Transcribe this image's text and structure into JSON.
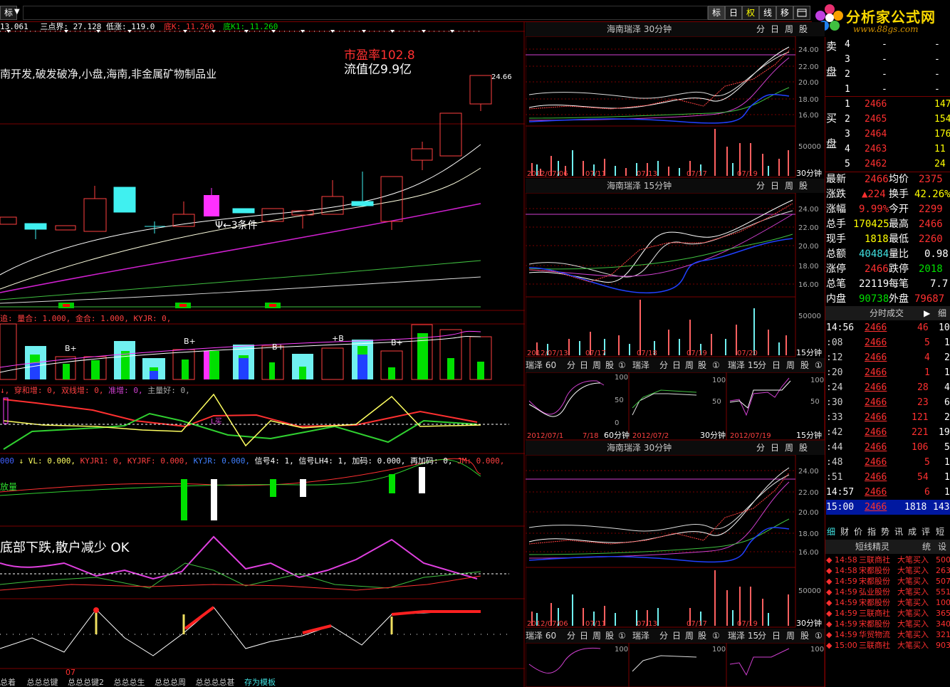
{
  "toolbar": {
    "left_label": "标",
    "dropdown_arrow": "▼",
    "buttons": [
      "标",
      "日",
      "权",
      "线",
      "移"
    ],
    "extra_icons": [
      "window-icon",
      "search-icon"
    ]
  },
  "logo": {
    "title": "分析家公式网",
    "url_text": "www.88gs.com"
  },
  "indicator_line": {
    "v1": "13.061",
    "san_dian_jie": "三点界: 27.128",
    "di_zhang": "低涨: 119.0",
    "di_k": "底K: 11.260",
    "di_k1": "底K1: 11.260"
  },
  "main_chart": {
    "concept_text": "南开发,破发破净,小盘,海南,非金属矿物制品业",
    "pe_text": "市盈率102.8",
    "float_text": "流值亿9.9亿",
    "high_label": "24.66",
    "cond_label": "Ψ←3条件"
  },
  "vol_indicator_line": {
    "text": "追: 量合: 1.000, 金合: 1.000, KYJR: 0,"
  },
  "vol_labels": [
    "B+",
    "B+",
    "B+",
    "+B",
    "B+"
  ],
  "ind2_line": {
    "prefix": "↓, 穿和增: 0, 双线增: 0,",
    "part2": "准增: 0,",
    "part3": "主量好: 0,"
  },
  "ind2_label": "L买",
  "ind3_line": {
    "a": "000",
    "b": "↓ VL: 0.000,",
    "c": "KYJR1: 0, KYJRF: 0.000,",
    "d": "KYJR: 0.000,",
    "e": "信号4: 1, 信号LH4: 1, 加码: 0.000, 再加码: 0,",
    "f": "JM: 0.000,"
  },
  "ind3_label": "放量",
  "ind4_text": "底部下跌,散户减少 OK",
  "bottom_tabs": [
    "总着",
    "总总总键",
    "总总总键2",
    "总总总生",
    "总总总周",
    "总总总总甚",
    "存为模板"
  ],
  "date_marker": "07",
  "mini_charts": {
    "c30_title": "海南瑞泽 30分钟",
    "c15_title": "海南瑞泽 15分钟",
    "c30b_title": "海南瑞泽 30分钟",
    "period_btns": [
      "分",
      "日",
      "周",
      "股"
    ],
    "y_ticks_a": [
      "24.00",
      "22.00",
      "20.00",
      "18.00",
      "16.00"
    ],
    "vol_tick": "50000",
    "dates_a": [
      "2012/07/06",
      "07/11",
      "07/13",
      "07/17",
      "07/19"
    ],
    "dates_b": [
      "2012/07/13",
      "07/17",
      "07/18",
      "07/19",
      "07/20"
    ],
    "label_30": "30分钟",
    "label_15": "15分钟",
    "label_60": "60分钟",
    "small_row_a": [
      "瑞泽 60",
      "分",
      "日",
      "周",
      "股",
      "①",
      "瑞泽",
      "分",
      "日",
      "周",
      "股",
      "①",
      "瑞泽 15",
      "分",
      "日",
      "周",
      "股",
      "①"
    ],
    "small_ticks": [
      "100",
      "50",
      "0"
    ],
    "small_dates": [
      "2012/07/1",
      "7/18",
      "2012/07/2",
      "2012/07/19"
    ]
  },
  "order_book": {
    "sell_label": [
      "卖",
      "盘"
    ],
    "buy_label": [
      "买",
      "盘"
    ],
    "sell": [
      {
        "n": "4",
        "price": "-",
        "vol": "-"
      },
      {
        "n": "3",
        "price": "-",
        "vol": "-"
      },
      {
        "n": "2",
        "price": "-",
        "vol": "-"
      },
      {
        "n": "1",
        "price": "-",
        "vol": "-"
      }
    ],
    "buy": [
      {
        "n": "1",
        "price": "2466",
        "vol": "147"
      },
      {
        "n": "2",
        "price": "2465",
        "vol": "154"
      },
      {
        "n": "3",
        "price": "2464",
        "vol": "176"
      },
      {
        "n": "4",
        "price": "2463",
        "vol": "11"
      },
      {
        "n": "5",
        "price": "2462",
        "vol": "24"
      }
    ]
  },
  "quote": [
    {
      "k1": "最新",
      "v1": "2466",
      "k2": "均价",
      "v2": "2375"
    },
    {
      "k1": "涨跌",
      "v1": "▲224",
      "k2": "换手",
      "v2": "42.26%"
    },
    {
      "k1": "涨幅",
      "v1": "9.99%",
      "k2": "今开",
      "v2": "2299"
    },
    {
      "k1": "总手",
      "v1": "170425",
      "k2": "最高",
      "v2": "2466"
    },
    {
      "k1": "现手",
      "v1": "1818",
      "k2": "最低",
      "v2": "2260"
    },
    {
      "k1": "总额",
      "v1": "40484",
      "k2": "量比",
      "v2": "0.98"
    },
    {
      "k1": "涨停",
      "v1": "2466",
      "k2": "跌停",
      "v2": "2018"
    },
    {
      "k1": "总笔",
      "v1": "22119",
      "k2": "每笔",
      "v2": "7.7"
    },
    {
      "k1": "内盘",
      "v1": "90738",
      "k2": "外盘",
      "v2": "79687"
    }
  ],
  "trade_header": {
    "title": "分时成交",
    "detail": "细"
  },
  "trades": [
    {
      "t": "14:56",
      "p": "2466",
      "v": "46",
      "n": "10"
    },
    {
      "t": ":08",
      "p": "2466",
      "v": "5",
      "n": "1"
    },
    {
      "t": ":12",
      "p": "2466",
      "v": "4",
      "n": "2"
    },
    {
      "t": ":20",
      "p": "2466",
      "v": "1",
      "n": "1"
    },
    {
      "t": ":24",
      "p": "2466",
      "v": "28",
      "n": "4"
    },
    {
      "t": ":30",
      "p": "2466",
      "v": "23",
      "n": "6"
    },
    {
      "t": ":33",
      "p": "2466",
      "v": "121",
      "n": "2"
    },
    {
      "t": ":42",
      "p": "2466",
      "v": "221",
      "n": "19"
    },
    {
      "t": ":44",
      "p": "2466",
      "v": "106",
      "n": "5"
    },
    {
      "t": ":48",
      "p": "2466",
      "v": "5",
      "n": "1"
    },
    {
      "t": ":51",
      "p": "2466",
      "v": "54",
      "n": "1"
    },
    {
      "t": "14:57",
      "p": "2466",
      "v": "6",
      "n": "1"
    },
    {
      "t": "15:00",
      "p": "2466",
      "v": "1818",
      "n": "143"
    }
  ],
  "tabs_row": [
    "细",
    "财",
    "价",
    "指",
    "势",
    "讯",
    "成",
    "评",
    "短"
  ],
  "signal_header": {
    "title": "短线精灵",
    "b1": "统",
    "b2": "设"
  },
  "signals": [
    {
      "t": "14:58",
      "name": "三联商社",
      "type": "大笔买入",
      "v": "500"
    },
    {
      "t": "14:58",
      "name": "宋都股份",
      "type": "大笔买入",
      "v": "263"
    },
    {
      "t": "14:59",
      "name": "宋都股份",
      "type": "大笔买入",
      "v": "507"
    },
    {
      "t": "14:59",
      "name": "弘业股份",
      "type": "大笔买入",
      "v": "551"
    },
    {
      "t": "14:59",
      "name": "宋都股份",
      "type": "大笔买入",
      "v": "100"
    },
    {
      "t": "14:59",
      "name": "三联商社",
      "type": "大笔买入",
      "v": "365"
    },
    {
      "t": "14:59",
      "name": "宋都股份",
      "type": "大笔买入",
      "v": "340"
    },
    {
      "t": "14:59",
      "name": "华贸物流",
      "type": "大笔买入",
      "v": "321"
    },
    {
      "t": "15:00",
      "name": "三联商社",
      "type": "大笔买入",
      "v": "903"
    }
  ]
}
